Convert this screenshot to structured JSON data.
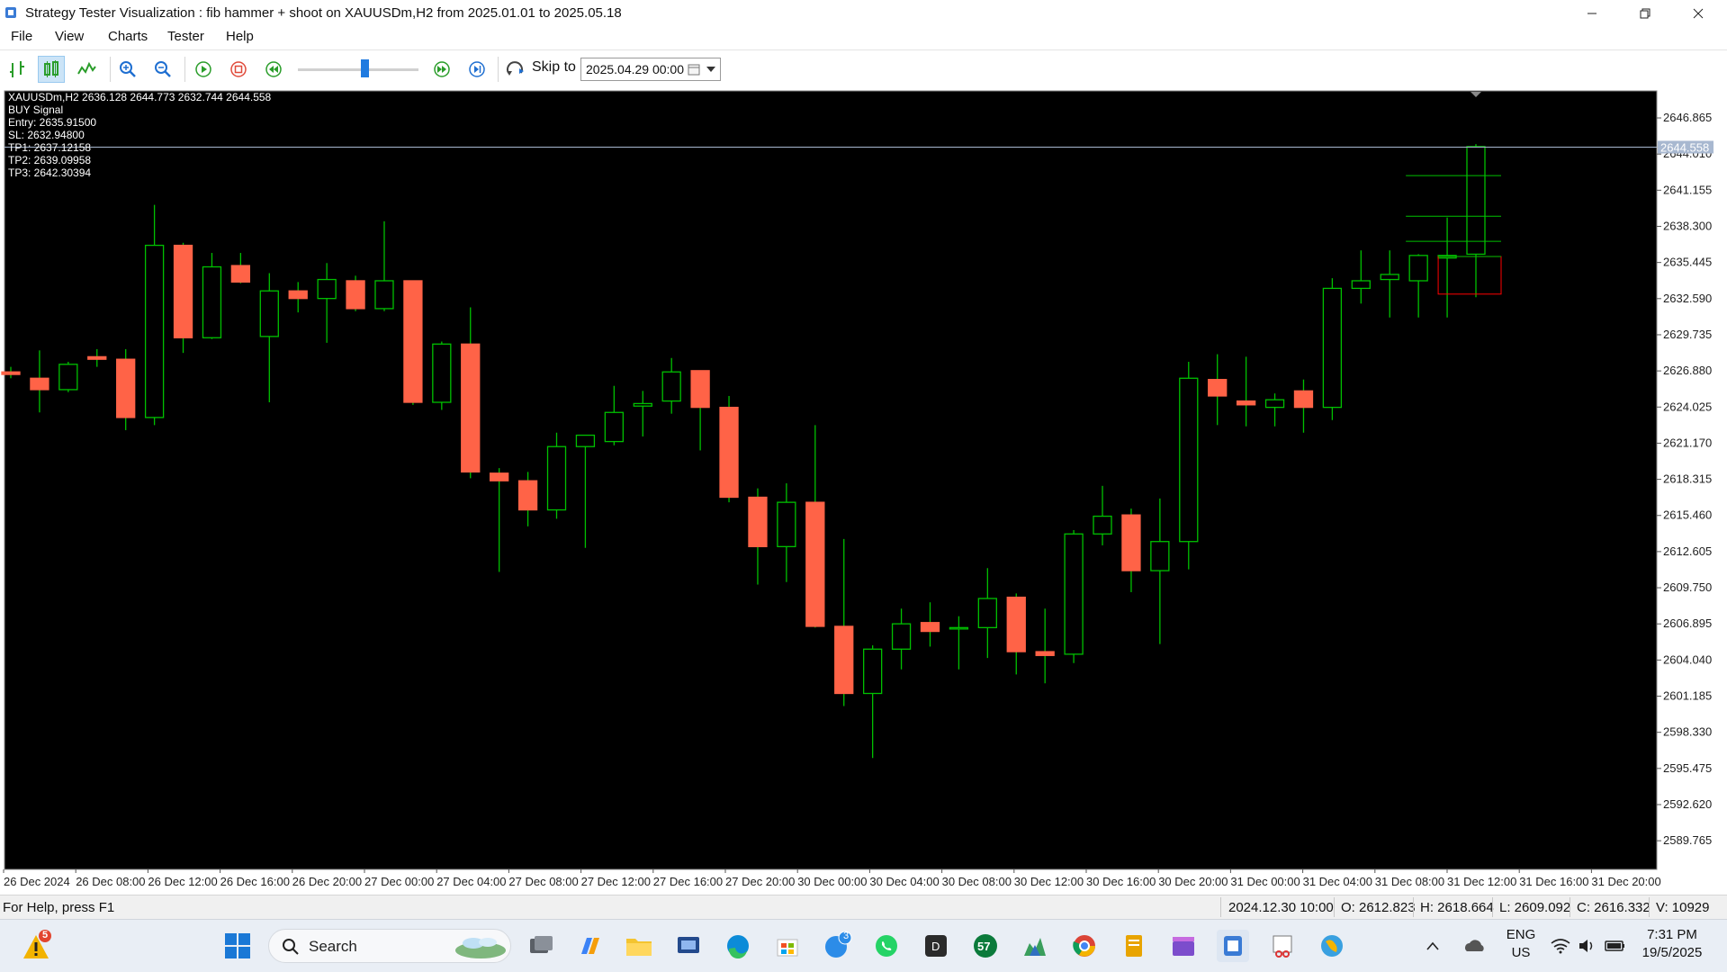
{
  "window": {
    "title": "Strategy Tester Visualization :  fib hammer + shoot on XAUUSDm,H2 from 2025.01.01 to 2025.05.18"
  },
  "menu": [
    "File",
    "View",
    "Charts",
    "Tester",
    "Help"
  ],
  "toolbar": {
    "icons": [
      "crosshair-icon",
      "candles-icon",
      "line-chart-icon",
      "zoom-in-icon",
      "zoom-out-icon",
      "play-icon",
      "stop-icon",
      "rewind-icon",
      "fast-forward-icon",
      "skip-end-icon",
      "skip-to-icon"
    ],
    "speed_slider_value": 0.55,
    "skip_to_label": "Skip to",
    "skip_to_value": "2025.04.29 00:00"
  },
  "chart": {
    "info_lines": [
      "XAUUSDm,H2  2636.128 2644.773 2632.744 2644.558",
      "BUY Signal",
      "Entry: 2635.91500",
      "SL: 2632.94800",
      "TP1: 2637.12158",
      "TP2: 2639.09958",
      "TP3: 2642.30394"
    ],
    "current_price_label": "2644.558",
    "colors": {
      "background": "#000000",
      "bull_outline": "#00c000",
      "bear_fill": "#ff6347",
      "red_zone": "#ff0000",
      "axis_text": "#ffffff"
    }
  },
  "chart_data": {
    "type": "candlestick",
    "symbol": "XAUUSDm,H2",
    "ylim": [
      2587.5,
      2649.0
    ],
    "y_ticks": [
      "2646.865",
      "2644.010",
      "2641.155",
      "2638.300",
      "2635.445",
      "2632.590",
      "2629.735",
      "2626.880",
      "2624.025",
      "2621.170",
      "2618.315",
      "2615.460",
      "2612.605",
      "2609.750",
      "2606.895",
      "2604.040",
      "2601.185",
      "2598.330",
      "2595.475",
      "2592.620",
      "2589.765"
    ],
    "x_ticks": [
      "26 Dec 2024",
      "26 Dec 08:00",
      "26 Dec 12:00",
      "26 Dec 16:00",
      "26 Dec 20:00",
      "27 Dec 00:00",
      "27 Dec 04:00",
      "27 Dec 08:00",
      "27 Dec 12:00",
      "27 Dec 16:00",
      "27 Dec 20:00",
      "30 Dec 00:00",
      "30 Dec 04:00",
      "30 Dec 08:00",
      "30 Dec 12:00",
      "30 Dec 16:00",
      "30 Dec 20:00",
      "31 Dec 00:00",
      "31 Dec 04:00",
      "31 Dec 08:00",
      "31 Dec 12:00",
      "31 Dec 16:00",
      "31 Dec 20:00"
    ],
    "candles": [
      {
        "o": 2626.8,
        "h": 2627.2,
        "l": 2626.3,
        "c": 2626.6
      },
      {
        "o": 2626.3,
        "h": 2628.5,
        "l": 2623.6,
        "c": 2625.4
      },
      {
        "o": 2625.4,
        "h": 2627.6,
        "l": 2625.2,
        "c": 2627.4
      },
      {
        "o": 2628.0,
        "h": 2628.6,
        "l": 2627.2,
        "c": 2627.8
      },
      {
        "o": 2627.8,
        "h": 2628.6,
        "l": 2622.2,
        "c": 2623.2
      },
      {
        "o": 2623.2,
        "h": 2640.0,
        "l": 2622.6,
        "c": 2636.8
      },
      {
        "o": 2636.8,
        "h": 2637.0,
        "l": 2628.3,
        "c": 2629.5
      },
      {
        "o": 2629.5,
        "h": 2636.2,
        "l": 2629.4,
        "c": 2635.1
      },
      {
        "o": 2635.2,
        "h": 2636.2,
        "l": 2633.8,
        "c": 2633.9
      },
      {
        "o": 2629.6,
        "h": 2634.6,
        "l": 2624.4,
        "c": 2633.2
      },
      {
        "o": 2633.2,
        "h": 2633.9,
        "l": 2631.5,
        "c": 2632.6
      },
      {
        "o": 2632.6,
        "h": 2635.4,
        "l": 2629.1,
        "c": 2634.1
      },
      {
        "o": 2634.0,
        "h": 2634.4,
        "l": 2631.6,
        "c": 2631.8
      },
      {
        "o": 2631.8,
        "h": 2638.7,
        "l": 2631.6,
        "c": 2634.0
      },
      {
        "o": 2634.0,
        "h": 2634.0,
        "l": 2624.2,
        "c": 2624.4
      },
      {
        "o": 2624.4,
        "h": 2629.2,
        "l": 2623.8,
        "c": 2629.0
      },
      {
        "o": 2629.0,
        "h": 2631.9,
        "l": 2618.4,
        "c": 2618.9
      },
      {
        "o": 2618.8,
        "h": 2619.2,
        "l": 2611.0,
        "c": 2618.2
      },
      {
        "o": 2618.2,
        "h": 2618.9,
        "l": 2614.6,
        "c": 2615.9
      },
      {
        "o": 2615.9,
        "h": 2622.0,
        "l": 2615.2,
        "c": 2620.9
      },
      {
        "o": 2620.9,
        "h": 2621.8,
        "l": 2612.9,
        "c": 2621.8
      },
      {
        "o": 2621.3,
        "h": 2625.7,
        "l": 2621.0,
        "c": 2623.6
      },
      {
        "o": 2624.1,
        "h": 2625.3,
        "l": 2621.7,
        "c": 2624.3
      },
      {
        "o": 2624.5,
        "h": 2627.9,
        "l": 2623.5,
        "c": 2626.8
      },
      {
        "o": 2626.9,
        "h": 2626.9,
        "l": 2620.6,
        "c": 2624.0
      },
      {
        "o": 2624.0,
        "h": 2624.9,
        "l": 2616.5,
        "c": 2616.9
      },
      {
        "o": 2616.9,
        "h": 2617.6,
        "l": 2610.0,
        "c": 2613.0
      },
      {
        "o": 2613.0,
        "h": 2618.0,
        "l": 2610.2,
        "c": 2616.5
      },
      {
        "o": 2616.5,
        "h": 2622.6,
        "l": 2606.6,
        "c": 2606.7
      },
      {
        "o": 2606.7,
        "h": 2613.6,
        "l": 2600.4,
        "c": 2601.4
      },
      {
        "o": 2601.4,
        "h": 2605.2,
        "l": 2596.3,
        "c": 2604.9
      },
      {
        "o": 2604.9,
        "h": 2608.1,
        "l": 2603.3,
        "c": 2606.9
      },
      {
        "o": 2607.0,
        "h": 2608.6,
        "l": 2605.1,
        "c": 2606.3
      },
      {
        "o": 2606.5,
        "h": 2607.5,
        "l": 2603.3,
        "c": 2606.6
      },
      {
        "o": 2606.6,
        "h": 2611.3,
        "l": 2604.2,
        "c": 2608.9
      },
      {
        "o": 2609.0,
        "h": 2609.3,
        "l": 2602.9,
        "c": 2604.7
      },
      {
        "o": 2604.7,
        "h": 2608.1,
        "l": 2602.2,
        "c": 2604.4
      },
      {
        "o": 2604.5,
        "h": 2614.3,
        "l": 2603.8,
        "c": 2614.0
      },
      {
        "o": 2614.0,
        "h": 2617.8,
        "l": 2613.1,
        "c": 2615.4
      },
      {
        "o": 2615.5,
        "h": 2616.0,
        "l": 2609.4,
        "c": 2611.1
      },
      {
        "o": 2611.1,
        "h": 2616.8,
        "l": 2605.3,
        "c": 2613.4
      },
      {
        "o": 2613.4,
        "h": 2627.6,
        "l": 2611.2,
        "c": 2626.3
      },
      {
        "o": 2626.2,
        "h": 2628.2,
        "l": 2622.6,
        "c": 2624.9
      },
      {
        "o": 2624.5,
        "h": 2628.0,
        "l": 2622.5,
        "c": 2624.2
      },
      {
        "o": 2624.0,
        "h": 2625.1,
        "l": 2622.5,
        "c": 2624.6
      },
      {
        "o": 2625.3,
        "h": 2626.2,
        "l": 2622.0,
        "c": 2624.0
      },
      {
        "o": 2624.0,
        "h": 2634.2,
        "l": 2623.0,
        "c": 2633.4
      },
      {
        "o": 2633.4,
        "h": 2636.4,
        "l": 2632.2,
        "c": 2634.0
      },
      {
        "o": 2634.1,
        "h": 2636.4,
        "l": 2631.1,
        "c": 2634.5
      },
      {
        "o": 2634.0,
        "h": 2636.1,
        "l": 2631.1,
        "c": 2636.0
      },
      {
        "o": 2635.8,
        "h": 2639.0,
        "l": 2631.1,
        "c": 2636.0
      },
      {
        "o": 2636.1,
        "h": 2644.8,
        "l": 2632.7,
        "c": 2644.6
      }
    ],
    "levels": {
      "entry": 2635.915,
      "sl": 2632.948,
      "tp1": 2637.12158,
      "tp2": 2639.09958,
      "tp3": 2642.30394,
      "current": 2644.558
    }
  },
  "status": {
    "help": "For Help, press F1",
    "datetime": "2024.12.30 10:00",
    "open": "O: 2612.823",
    "high": "H: 2618.664",
    "low": "L: 2609.092",
    "close": "C: 2616.332",
    "volume": "V: 10929"
  },
  "taskbar": {
    "weather_badge": "5",
    "search_label": "Search",
    "messenger_badge": "3",
    "lang_top": "ENG",
    "lang_bottom": "US",
    "time": "7:31 PM",
    "date": "19/5/2025"
  }
}
